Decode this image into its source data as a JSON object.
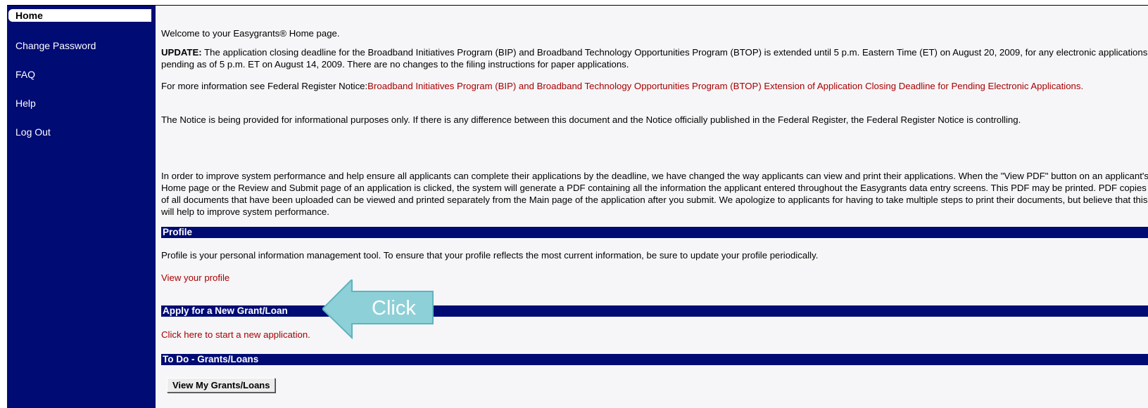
{
  "sidebar": {
    "home": "Home",
    "items": [
      {
        "label": "Change Password"
      },
      {
        "label": "FAQ"
      },
      {
        "label": "Help"
      },
      {
        "label": "Log Out"
      }
    ]
  },
  "main": {
    "welcome": "Welcome to your Easygrants® Home page.",
    "update_label": "UPDATE:",
    "update_text": " The application closing deadline for the Broadband Initiatives Program (BIP) and Broadband Technology Opportunities Program (BTOP) is extended until 5 p.m. Eastern Time (ET) on August 20, 2009, for any electronic applications pending as of 5 p.m. ET on August 14, 2009. There are no changes to the filing instructions for paper applications.",
    "more_info_prefix": "For more information see Federal Register Notice:",
    "more_info_link": "Broadband Initiatives Program (BIP) and Broadband Technology Opportunities Program (BTOP) Extension of Application Closing Deadline for Pending Electronic Applications.",
    "notice_text": "The Notice is being provided for informational purposes only. If there is any difference between this document and the Notice officially published in the Federal Register, the Federal Register Notice is controlling.",
    "performance_text": "In order to improve system performance and help ensure all applicants can complete their applications by the deadline, we have changed the way applicants can view and print their applications. When the \"View PDF\" button on an applicant's Home page or the Review and Submit page of an application is clicked, the system will generate a PDF containing all the information the applicant entered throughout the Easygrants data entry screens. This PDF may be printed. PDF copies of all documents that have been uploaded can be viewed and printed separately from the Main page of the application after you submit. We apologize to applicants for having to take multiple steps to print their documents, but believe that this will help to improve system performance.",
    "profile": {
      "header": "Profile",
      "description": "Profile is your personal information management tool. To ensure that your profile reflects the most current information, be sure to update your profile periodically.",
      "link": "View your profile"
    },
    "apply": {
      "header": "Apply for a New Grant/Loan",
      "link": "Click here to start a new application."
    },
    "todo": {
      "header": "To Do - Grants/Loans",
      "button": "View My Grants/Loans"
    }
  },
  "callout": {
    "text": "Click",
    "icon": "left-arrow-callout-icon",
    "fill_color": "#8ed0d8",
    "stroke_color": "#5fb3bf"
  },
  "colors": {
    "sidebar_bg": "#000b73",
    "section_bar": "#000b73",
    "link": "#a80000",
    "page_bg": "#f6f6f8"
  }
}
